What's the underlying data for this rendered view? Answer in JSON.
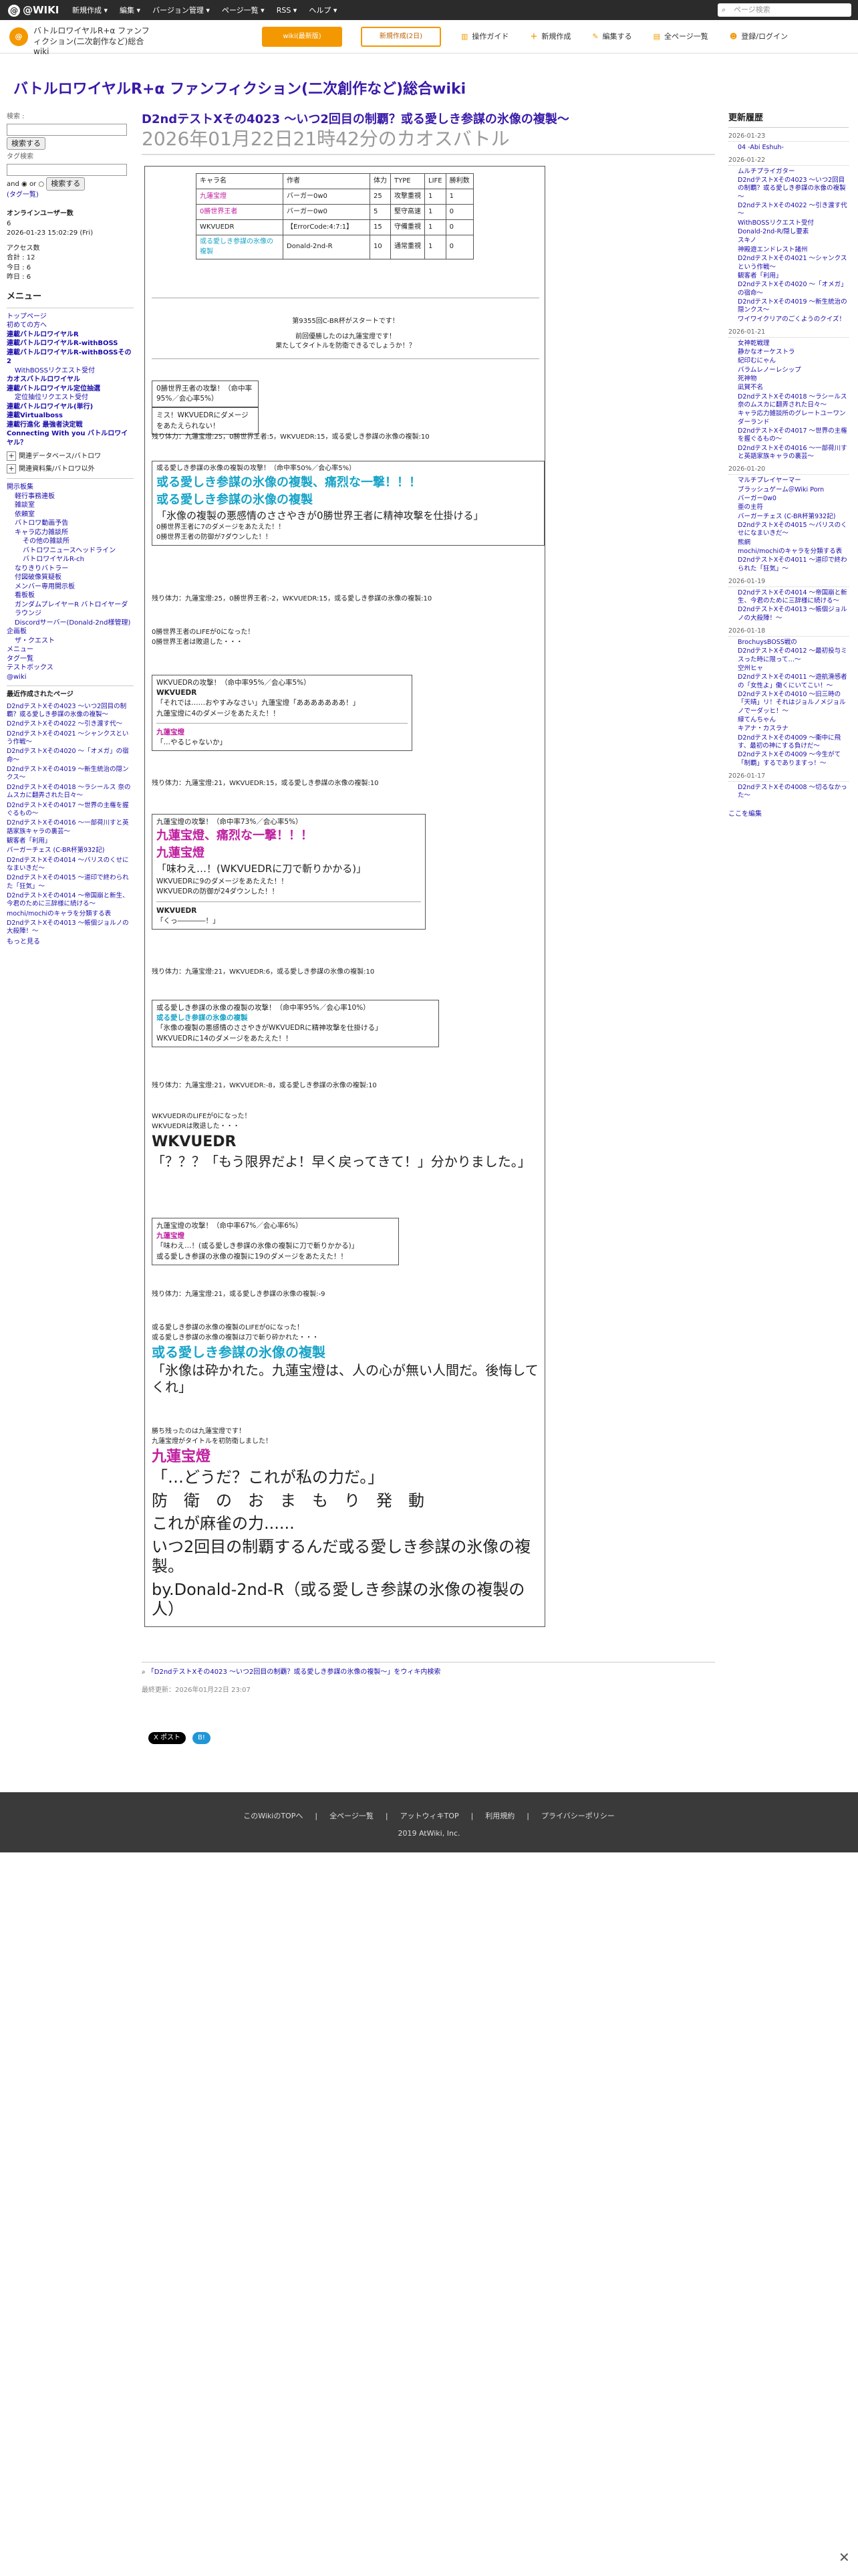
{
  "topbar": {
    "logo": "@WIKI",
    "menu": [
      "新規作成 ▾",
      "編集 ▾",
      "バージョン管理 ▾",
      "ページ一覧 ▾",
      "RSS ▾",
      "ヘルプ ▾"
    ],
    "search_placeholder": "ページ検索"
  },
  "wikibar": {
    "title": "バトルロワイヤルR+α ファンフィクション(二次創作など)総合wiki",
    "btn1": "wiki(最新版)",
    "btn2": "新規作成(2日)",
    "tools": [
      "操作ガイド",
      "新規作成",
      "編集する",
      "全ページ一覧",
      "登録/ログイン"
    ]
  },
  "site_title": "バトルロワイヤルR+α ファンフィクション(二次創作など)総合wiki",
  "left": {
    "search_label": "検索 :",
    "search_btn": "検索する",
    "tag_label": "タグ検索",
    "and": "and",
    "or": "or",
    "tag_btn": "検索する",
    "tag_link": "(タグ一覧)",
    "online": "オンラインユーザー数",
    "online_count": "6",
    "date": "2026-01-23 15:02:29 (Fri)",
    "access_label": "アクセス数",
    "total": "合計 : 12",
    "today": "今日 : 6",
    "yesterday": "昨日 : 6",
    "menu_title": "メニュー",
    "nav": [
      {
        "t": "トップページ",
        "c": ""
      },
      {
        "t": "初めての方へ",
        "c": ""
      },
      {
        "t": "連載バトルロワイヤルR",
        "c": "b"
      },
      {
        "t": "連載バトルロワイヤルR-withBOSS",
        "c": "b"
      },
      {
        "t": "連載バトルロワイヤルR-withBOSSその2",
        "c": "b"
      },
      {
        "t": "WithBOSSリクエスト受付",
        "c": "ind1"
      },
      {
        "t": "カオスバトルロワイヤル",
        "c": "b"
      },
      {
        "t": "連載バトルロワイヤル定位抽選",
        "c": "b"
      },
      {
        "t": "定位抽位リクエスト受付",
        "c": "ind1"
      },
      {
        "t": "連載バトルロワイヤル(単行)",
        "c": "b"
      },
      {
        "t": "連載Virtualboss",
        "c": "b"
      },
      {
        "t": "連載行進化 最強者決定戦",
        "c": "b"
      },
      {
        "t": "Connecting With you バトルロワイヤル？",
        "c": "b"
      }
    ],
    "nav2": [
      "関連データベース/バトロワ",
      "関連資料集/バトロワ以外"
    ],
    "nav3": [
      {
        "t": "開示板集",
        "c": ""
      },
      {
        "t": "軽行事務連板",
        "c": "ind1"
      },
      {
        "t": "雑談室",
        "c": "ind1"
      },
      {
        "t": "依頼室",
        "c": "ind1"
      },
      {
        "t": "バトロワ動画予告",
        "c": "ind1"
      },
      {
        "t": "キャラ応力雑談所",
        "c": "ind1"
      },
      {
        "t": "その他の雑談所",
        "c": "ind2"
      },
      {
        "t": "バトロワニュースヘッドライン",
        "c": "ind2"
      },
      {
        "t": "バトロワイヤルR-ch",
        "c": "ind2"
      },
      {
        "t": "なりきりバトラー",
        "c": "ind1"
      },
      {
        "t": "付図破像質疑板",
        "c": "ind1"
      },
      {
        "t": "メンバー専用開示板",
        "c": "ind1"
      },
      {
        "t": "看板板",
        "c": "ind1"
      },
      {
        "t": "ガンダムプレイヤーR バトロイヤーダラウンジ",
        "c": "ind1"
      },
      {
        "t": "Discordサーバー(Donald-2nd様管理)",
        "c": "ind1"
      },
      {
        "t": "企画板",
        "c": ""
      },
      {
        "t": "ザ・クエスト",
        "c": "ind1"
      },
      {
        "t": "メニュー",
        "c": ""
      },
      {
        "t": "タグ一覧",
        "c": ""
      },
      {
        "t": "テストボックス",
        "c": ""
      },
      {
        "t": "@wiki",
        "c": ""
      }
    ],
    "recent_title": "最近作成されたページ",
    "recent": [
      "D2ndテストXその4023 ～いつ2回目の制覇？或る愛しき参謀の氷像の複製～",
      "D2ndテストXその4022 ～引き渡す代～",
      "D2ndテストXその4021 ～シャンクスという作戦～",
      "D2ndテストXその4020 ～「オメガ」の宿命～",
      "D2ndテストXその4019 ～新生統治の隠ンクス～",
      "D2ndテストXその4018 ～ラシールス 奈のムスカに翻弄された日々～",
      "D2ndテストXその4017 ～世界の主権を握ぐるもの～",
      "D2ndテストXその4016 ～一部荷川すと英語家族キャラの裏芸～",
      "観客者「利用」",
      "バーガーチェス (C-BR杯第932記)",
      "D2ndテストXその4014 ～バリスのくせになまいきだ～",
      "D2ndテストXその4015 ～道印で終わられた「狂気」～",
      "D2ndテストXその4014 ～帝国崩と新生、今君のために三辞様に続ける～",
      "mochi/mochiのキャラを分類する表",
      "D2ndテストXその4013 ～帳個ジョルノの大殺陣！～"
    ],
    "more": "もっと見る"
  },
  "main": {
    "title": "D2ndテストXその4023 ～いつ2回目の制覇？或る愛しき参謀の氷像の複製～",
    "subtitle": "2026年01月22日21時42分のカオスバトル",
    "table_head": [
      "キャラ名",
      "作者",
      "体力",
      "TYPE",
      "LIFE",
      "勝利数"
    ],
    "table_rows": [
      [
        "九蓮宝燈",
        "バーガー0w0",
        "25",
        "攻撃重視",
        "1",
        "1"
      ],
      [
        "0勝世界王者",
        "バーガー0w0",
        "5",
        "堅守高速",
        "1",
        "0"
      ],
      [
        "WKVUEDR",
        "【ErrorCode:4:7:1】",
        "15",
        "守備重視",
        "1",
        "0"
      ],
      [
        "或る愛しき参謀の氷像の複製",
        "Donald-2nd-R",
        "10",
        "通常重視",
        "1",
        "0"
      ]
    ],
    "start1": "第9355回C-BR杯がスタートです！",
    "start2": "前回優勝したのは九蓮宝燈です！",
    "start3": "果たしてタイトルを防衛できるでしょうか！？",
    "b1a": "0勝世界王者の攻撃！（命中率95%／会心率5%）",
    "b1b": "ミス！WKVUEDRにダメージをあたえられない！",
    "rem1": "残り体力：九蓮宝燈:25，0勝世界王者:5，WKVUEDR:15，或る愛しき参謀の氷像の複製:10",
    "b2a": "或る愛しき参謀の氷像の複製の攻撃！（命中率50%／会心率5%）",
    "b2b": "或る愛しき参謀の氷像の複製、痛烈な一撃！！！",
    "b2c": "或る愛しき参謀の氷像の複製",
    "b2d": "「氷像の複製の悪感情のささやきが0勝世界王者に精神攻撃を仕掛ける」",
    "b2e": "0勝世界王者に7のダメージをあたえた！！",
    "b2f": "0勝世界王者の防御が7ダウンした！！",
    "rem2": "残り体力：九蓮宝燈:25，0勝世界王者:-2，WKVUEDR:15，或る愛しき参謀の氷像の複製:10",
    "d1": "0勝世界王者のLIFEが0になった！",
    "d2": "0勝世界王者は敗退した・・・",
    "b3a": "WKVUEDRの攻撃！（命中率95%／会心率5%）",
    "b3b": "WKVUEDR",
    "b3c": "「それでは……おやすみなさい」九蓮宝燈「あああああああ！」",
    "b3d": "九蓮宝燈に4のダメージをあたえた！！",
    "b3e": "九蓮宝燈",
    "b3f": "「…やるじゃないか」",
    "rem3": "残り体力：九蓮宝燈:21，WKVUEDR:15，或る愛しき参謀の氷像の複製:10",
    "b4a": "九蓮宝燈の攻撃！（命中率73%／会心率5%）",
    "b4b": "九蓮宝燈、痛烈な一撃！！！",
    "b4c": "九蓮宝燈",
    "b4d": "「味わえ…！(WKVUEDRに刀で斬りかかる)」",
    "b4e": "WKVUEDRに9のダメージをあたえた！！",
    "b4f": "WKVUEDRの防御が24ダウンした！！",
    "b4g": "WKVUEDR",
    "b4h": "「くっ――――！」",
    "rem4": "残り体力：九蓮宝燈:21，WKVUEDR:6，或る愛しき参謀の氷像の複製:10",
    "b5a": "或る愛しき参謀の氷像の複製の攻撃！（命中率95%／会心率10%）",
    "b5b": "或る愛しき参謀の氷像の複製",
    "b5c": "「氷像の複製の悪感情のささやきがWKVUEDRに精神攻撃を仕掛ける」",
    "b5d": "WKVUEDRに14のダメージをあたえた！！",
    "rem5": "残り体力：九蓮宝燈:21，WKVUEDR:-8，或る愛しき参謀の氷像の複製:10",
    "d3": "WKVUEDRのLIFEが0になった！",
    "d4": "WKVUEDRは敗退した・・・",
    "d5": "WKVUEDR",
    "d6": "「？？？「もう限界だよ！早く戻ってきて！」分かりました。」",
    "b6a": "九蓮宝燈の攻撃！（命中率67%／会心率6%）",
    "b6b": "九蓮宝燈",
    "b6c": "「味わえ…！(或る愛しき参謀の氷像の複製に刀で斬りかかる)」",
    "b6d": "或る愛しき参謀の氷像の複製に19のダメージをあたえた！！",
    "rem6": "残り体力：九蓮宝燈:21，或る愛しき参謀の氷像の複製:-9",
    "d7": "或る愛しき参謀の氷像の複製のLIFEが0になった！",
    "d8": "或る愛しき参謀の氷像の複製は刀で斬り砕かれた・・・",
    "d9": "或る愛しき参謀の氷像の複製",
    "d10": "「氷像は砕かれた。九蓮宝燈は、人の心が無い人間だ。後悔してくれ」",
    "w1": "勝ち残ったのは九蓮宝燈です！",
    "w2": "九蓮宝燈がタイトルを初防衛しました！",
    "w3": "九蓮宝燈",
    "w4": "「…どうだ？これが私の力だ。」",
    "w5": "防　衛　の　お　ま　も　り　発　動",
    "w6": "これが麻雀の力......",
    "w7": "いつ2回目の制覇するんだ或る愛しき参謀の氷像の複製。",
    "w8": "by.Donald-2nd-R（或る愛しき参謀の氷像の複製の人）",
    "search_link": "「D2ndテストXその4023 ～いつ2回目の制覇？或る愛しき参謀の氷像の複製～」をウィキ内検索",
    "updated": "最終更新：2026年01月22日 23:07"
  },
  "right": {
    "title": "更新履歴",
    "groups": [
      {
        "d": "2026-01-23",
        "i": [
          "04 -Abi Eshuh-"
        ]
      },
      {
        "d": "2026-01-22",
        "i": [
          "ムルチプライガター",
          "D2ndテストXその4023 ～いつ2回目の制覇？或る愛しき参謀の氷像の複製～",
          "D2ndテストXその4022 ～引き渡す代～",
          "WithBOSSリクエスト受付",
          "Donald-2nd-R/隠し要素",
          "スキノ",
          "神殿遊エンドレスト諸州",
          "D2ndテストXその4021 ～シャンクスという作戦～",
          "観客者「利用」",
          "D2ndテストXその4020 ～「オメガ」の宿命～",
          "D2ndテストXその4019 ～新生統治の隠ンクス～",
          "ワイワイクリアのごくようのクイズ！"
        ]
      },
      {
        "d": "2026-01-21",
        "i": [
          "女神乾戦理",
          "静かなオーケストラ",
          "紀印むにゃん",
          "バラムレノーレシップ",
          "死神物",
          "凪賀不名",
          "D2ndテストXその4018 ～ラシールス 奈のムスカに翻弄された日々～",
          "キャラ応力雑談所のグレートユーワンダーランド",
          "D2ndテストXその4017 ～世界の主権を握ぐるもの～",
          "D2ndテストXその4016 ～一部荷川すと英語家族キャラの裏芸～"
        ]
      },
      {
        "d": "2026-01-20",
        "i": [
          "マルチプレイヤーマー",
          "ブラッシュゲーム＠Wiki Porn",
          "バーガー0w0",
          "亜の主符",
          "バーガーチェス (C-BR杯第932記)",
          "D2ndテストXその4015 ～バリスのくせになまいきだ～",
          "熊網",
          "mochi/mochiのキャラを分類する表",
          "D2ndテストXその4011 ～道印で終わられた「狂気」～"
        ]
      },
      {
        "d": "2026-01-19",
        "i": [
          "D2ndテストXその4014 ～帝国崩と新生、今君のために三辞様に続ける～",
          "D2ndテストXその4013 ～帳個ジョルノの大殺陣！～"
        ]
      },
      {
        "d": "2026-01-18",
        "i": [
          "BrochuysBOSS戦の",
          "D2ndテストXその4012 ～最初投与ミスった時に限って…～",
          "空州ヒャ",
          "D2ndテストXその4011 ～遊航滑感者の「女性よ」働くにいてこい！～",
          "D2ndテストXその4010 ～旧三時の「天晴」リ！それはジョルノメジョルノでーダッヒ！～",
          "緑てんちゃん",
          "キアナ・カスラナ",
          "D2ndテストXその4009 ～衝中に飛す、最初の神にする負けだ～",
          "D2ndテストXその4009 ～今生がて「制覇」するでありますっ！～"
        ]
      },
      {
        "d": "2026-01-17",
        "i": [
          "D2ndテストXその4008 ～切るなかった～"
        ]
      }
    ],
    "more": "ここを編集"
  },
  "share": [
    "X ポスト",
    "B!"
  ],
  "footer": {
    "links": [
      "このWikiのTOPへ",
      "全ページ一覧",
      "アットウィキTOP",
      "利用規約",
      "プライバシーポリシー"
    ],
    "copyright": "2019 AtWiki, Inc."
  },
  "close": "✕"
}
